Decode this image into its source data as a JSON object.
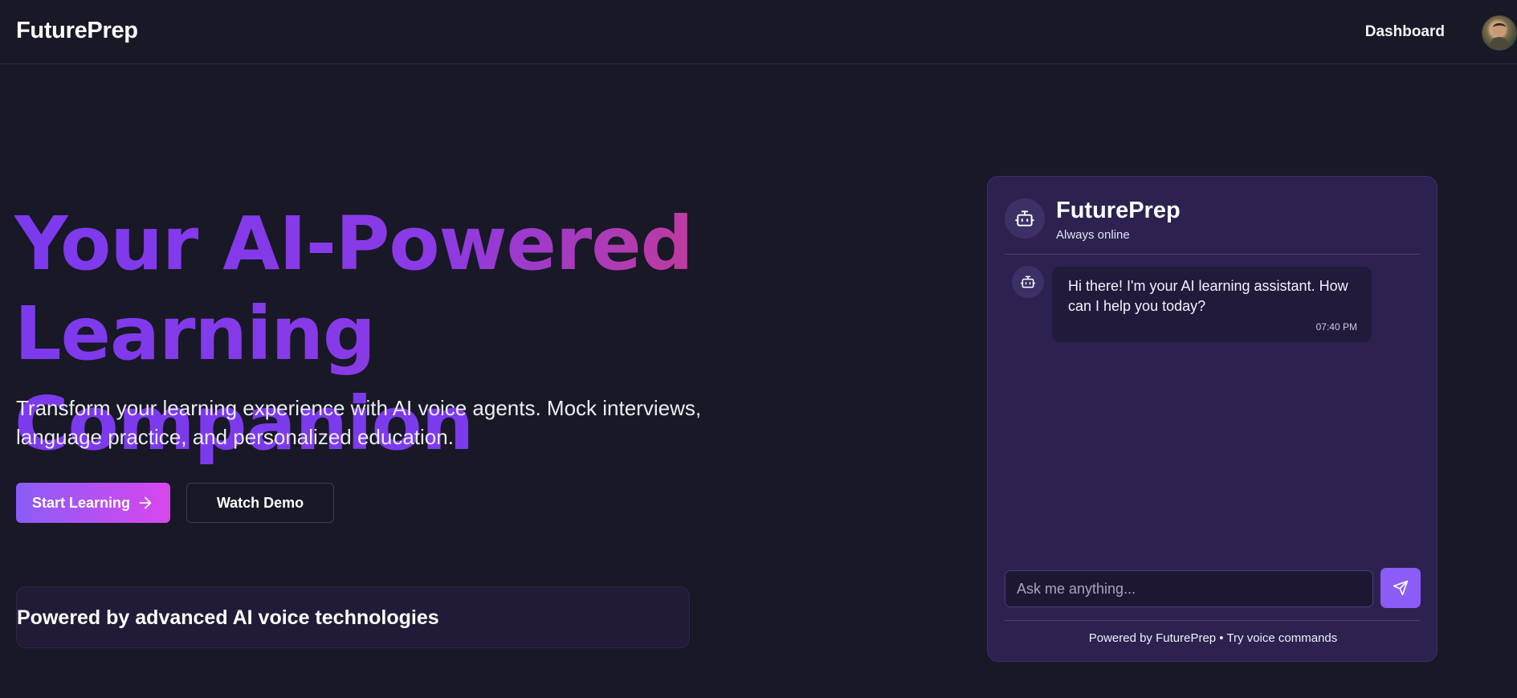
{
  "navbar": {
    "brand": "FuturePrep",
    "dashboard_label": "Dashboard"
  },
  "hero": {
    "title_line1": "Your AI-Powered Learning",
    "title_line2": "Companion",
    "subtitle": "Transform your learning experience with AI voice agents. Mock interviews, language practice, and personalized education.",
    "start_button": "Start Learning",
    "watch_button": "Watch Demo",
    "powered_text": "Powered by advanced AI voice technologies"
  },
  "chat": {
    "title": "FuturePrep",
    "status": "Always online",
    "messages": [
      {
        "text": "Hi there! I'm your AI learning assistant. How can I help you today?",
        "time": "07:40 PM"
      }
    ],
    "input_placeholder": "Ask me anything...",
    "footer": "Powered by FuturePrep • Try voice commands"
  },
  "colors": {
    "background": "#181826",
    "accent_purple": "#7c3aed",
    "accent_red": "#ef4444",
    "chat_panel": "#2d2150",
    "send_button": "#8b5cf6"
  }
}
